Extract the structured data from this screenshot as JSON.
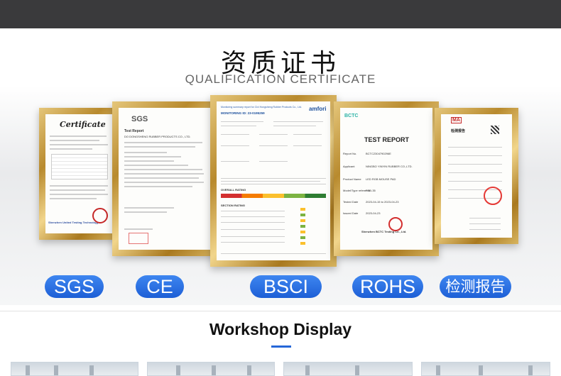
{
  "heading": {
    "cn": "资质证书",
    "en": "QUALIFICATION CERTIFICATE"
  },
  "certificates": {
    "cert1": {
      "title": "Certificate",
      "footer": "Shenzhen United Testing Technology"
    },
    "cert2": {
      "logo": "SGS",
      "label": "Test Report",
      "company": "DO DONGSHENG RUBBER PRODUCTS CO., LTD."
    },
    "cert3": {
      "header": "Monitoring summary report for Cixi Hongsheng Rubber Products Co., Ltd.",
      "logo": "amfori",
      "id": "MONITORING ID: 23-0195259",
      "section": "SECTION RATING",
      "overall": "OVERALL RATING"
    },
    "cert4": {
      "logo": "BCTC",
      "title": "TEST REPORT",
      "rows": [
        {
          "label": "Report No.",
          "value": "BCTC2304790296E"
        },
        {
          "label": "Applicant",
          "value": "NINGBO YINYIN RUBBER CO.,LTD."
        },
        {
          "label": "Product Name",
          "value": "LED RGB MOUSE PAD"
        },
        {
          "label": "Model/Type reference",
          "value": "FSD-35"
        },
        {
          "label": "Tested Date",
          "value": "2023-04-15 to 2023-04-23"
        },
        {
          "label": "Issued Date",
          "value": "2023-04-23"
        }
      ],
      "footer": "Shenzhen BCTC Testing Co., Ltd."
    },
    "cert5": {
      "mark": "MA",
      "title": "检测报告"
    }
  },
  "badges": [
    "SGS",
    "CE",
    "BSCI",
    "ROHS",
    "检测报告"
  ],
  "workshop": {
    "title": "Workshop Display"
  }
}
